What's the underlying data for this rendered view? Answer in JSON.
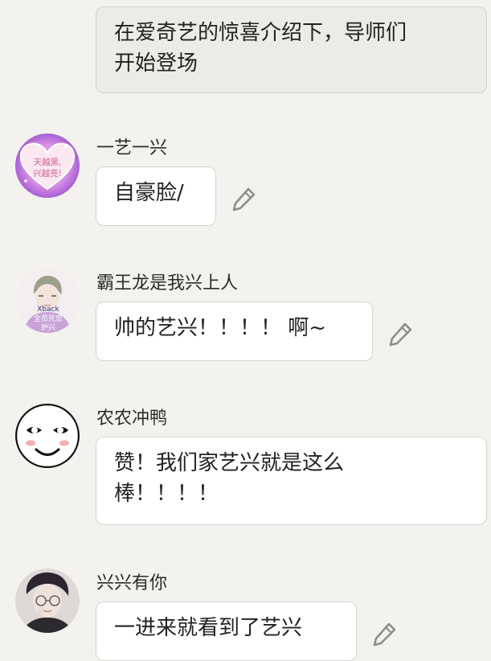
{
  "messages": {
    "top": {
      "text": "在爱奇艺的惊喜介绍下，导师们\n开始登场"
    },
    "items": [
      {
        "username": "一艺一兴",
        "text": "自豪脸/",
        "avatar_text": [
          "天越黑,",
          "兴越亮!"
        ],
        "avatar_icon": "heart-frame-avatar"
      },
      {
        "username": "霸王龙是我兴上人",
        "text": "帅的艺兴！！！！ 啊~",
        "avatar_text": [
          "Xback",
          "全员死忠",
          "护兴"
        ],
        "avatar_icon": "illustrated-boy-avatar"
      },
      {
        "username": "农农冲鸭",
        "text": "赞！我们家艺兴就是这么\n棒！！！！",
        "avatar_icon": "smiley-face-avatar"
      },
      {
        "username": "兴兴有你",
        "text": "一进来就看到了艺兴",
        "avatar_icon": "illustrated-man-avatar"
      }
    ]
  },
  "icons": {
    "edit": "pencil-icon"
  },
  "colors": {
    "background": "#f3f2ee",
    "bubble": "#ffffff",
    "top_bubble": "#ecebe7",
    "border": "#d6d4cf",
    "text": "#222222",
    "icon": "#8d8d8d"
  }
}
